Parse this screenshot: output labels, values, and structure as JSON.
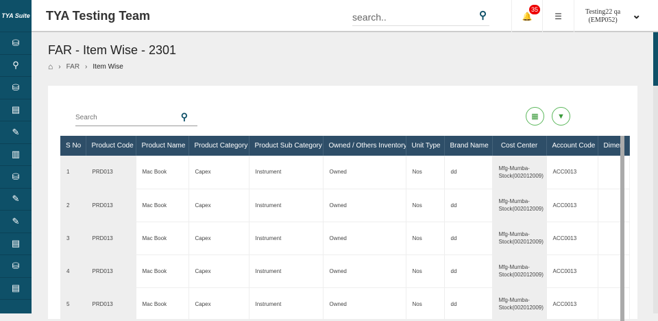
{
  "sidebar": {
    "logo": "TYA Suite",
    "icons": [
      "database-icon",
      "location-icon",
      "database-icon",
      "document-icon",
      "edit-document-icon",
      "report-icon",
      "database-icon",
      "edit-document-icon",
      "edit-document-icon",
      "document-icon",
      "database-icon",
      "document-icon"
    ]
  },
  "header": {
    "title": "TYA Testing Team",
    "search_placeholder": "search..",
    "notification_count": "35",
    "user_name": "Testing22 qa",
    "user_id": "(EMP052)"
  },
  "page": {
    "title": "FAR - Item Wise - 2301",
    "breadcrumb": [
      "FAR",
      "Item Wise"
    ]
  },
  "toolbar": {
    "search_placeholder": "Search"
  },
  "table": {
    "columns": [
      "S No",
      "Product Code",
      "Product Name",
      "Product Category",
      "Product Sub Category",
      "Owned / Others Inventory",
      "Unit Type",
      "Brand Name",
      "Cost Center",
      "Account Code",
      "Dimen"
    ],
    "rows": [
      [
        "1",
        "PRD013",
        "Mac Book",
        "Capex",
        "Instrument",
        "Owned",
        "Nos",
        "dd",
        "Mfg-Mumba-Stock(002012009)",
        "ACC0013",
        ""
      ],
      [
        "2",
        "PRD013",
        "Mac Book",
        "Capex",
        "Instrument",
        "Owned",
        "Nos",
        "dd",
        "Mfg-Mumba-Stock(002012009)",
        "ACC0013",
        ""
      ],
      [
        "3",
        "PRD013",
        "Mac Book",
        "Capex",
        "Instrument",
        "Owned",
        "Nos",
        "dd",
        "Mfg-Mumba-Stock(002012009)",
        "ACC0013",
        ""
      ],
      [
        "4",
        "PRD013",
        "Mac Book",
        "Capex",
        "Instrument",
        "Owned",
        "Nos",
        "dd",
        "Mfg-Mumba-Stock(002012009)",
        "ACC0013",
        ""
      ],
      [
        "5",
        "PRD013",
        "Mac Book",
        "Capex",
        "Instrument",
        "Owned",
        "Nos",
        "dd",
        "Mfg-Mumba-Stock(002012009)",
        "ACC0013",
        ""
      ]
    ]
  }
}
